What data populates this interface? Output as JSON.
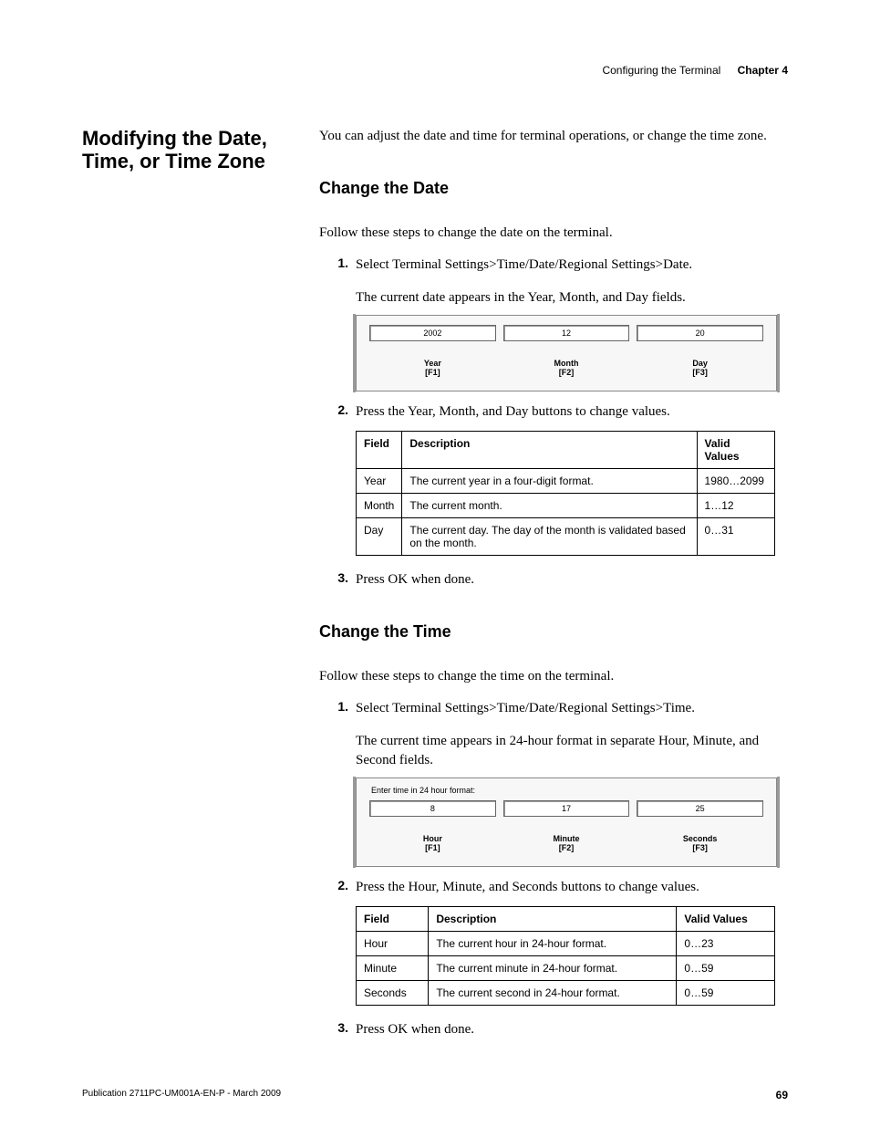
{
  "header": {
    "section": "Configuring the Terminal",
    "chapter": "Chapter 4"
  },
  "main": {
    "title": "Modifying the Date, Time, or Time Zone",
    "intro": "You can adjust the date and time for terminal operations, or change the time zone."
  },
  "dateSection": {
    "heading": "Change the Date",
    "lead": "Follow these steps to change the date on the terminal.",
    "step1": "Select Terminal Settings>Time/Date/Regional Settings>Date.",
    "step1b": "The current date appears in the Year, Month, and Day fields.",
    "ui": {
      "year_val": "2002",
      "month_val": "12",
      "day_val": "20",
      "year_lbl": "Year",
      "year_fn": "[F1]",
      "month_lbl": "Month",
      "month_fn": "[F2]",
      "day_lbl": "Day",
      "day_fn": "[F3]"
    },
    "step2": "Press the Year, Month, and Day buttons to change values.",
    "table": {
      "h1": "Field",
      "h2": "Description",
      "h3": "Valid Values",
      "r1c1": "Year",
      "r1c2": "The current year in a four-digit format.",
      "r1c3": "1980…2099",
      "r2c1": "Month",
      "r2c2": "The current month.",
      "r2c3": "1…12",
      "r3c1": "Day",
      "r3c2": "The current day. The day of the month is validated based on the month.",
      "r3c3": "0…31"
    },
    "step3": "Press OK when done."
  },
  "timeSection": {
    "heading": "Change the Time",
    "lead": "Follow these steps to change the time on the terminal.",
    "step1": "Select Terminal Settings>Time/Date/Regional Settings>Time.",
    "step1b": "The current time appears in 24-hour format in separate Hour, Minute, and Second fields.",
    "ui": {
      "prompt": "Enter time in 24 hour format:",
      "hour_val": "8",
      "min_val": "17",
      "sec_val": "25",
      "hour_lbl": "Hour",
      "hour_fn": "[F1]",
      "min_lbl": "Minute",
      "min_fn": "[F2]",
      "sec_lbl": "Seconds",
      "sec_fn": "[F3]"
    },
    "step2": "Press the Hour, Minute, and Seconds buttons to change values.",
    "table": {
      "h1": "Field",
      "h2": "Description",
      "h3": "Valid Values",
      "r1c1": "Hour",
      "r1c2": "The current hour in 24-hour format.",
      "r1c3": "0…23",
      "r2c1": "Minute",
      "r2c2": "The current minute in 24-hour format.",
      "r2c3": "0…59",
      "r3c1": "Seconds",
      "r3c2": "The current second in 24-hour format.",
      "r3c3": "0…59"
    },
    "step3": "Press OK when done."
  },
  "footer": {
    "pub": "Publication 2711PC-UM001A-EN-P - March 2009",
    "page": "69"
  },
  "nums": {
    "n1": "1.",
    "n2": "2.",
    "n3": "3."
  }
}
